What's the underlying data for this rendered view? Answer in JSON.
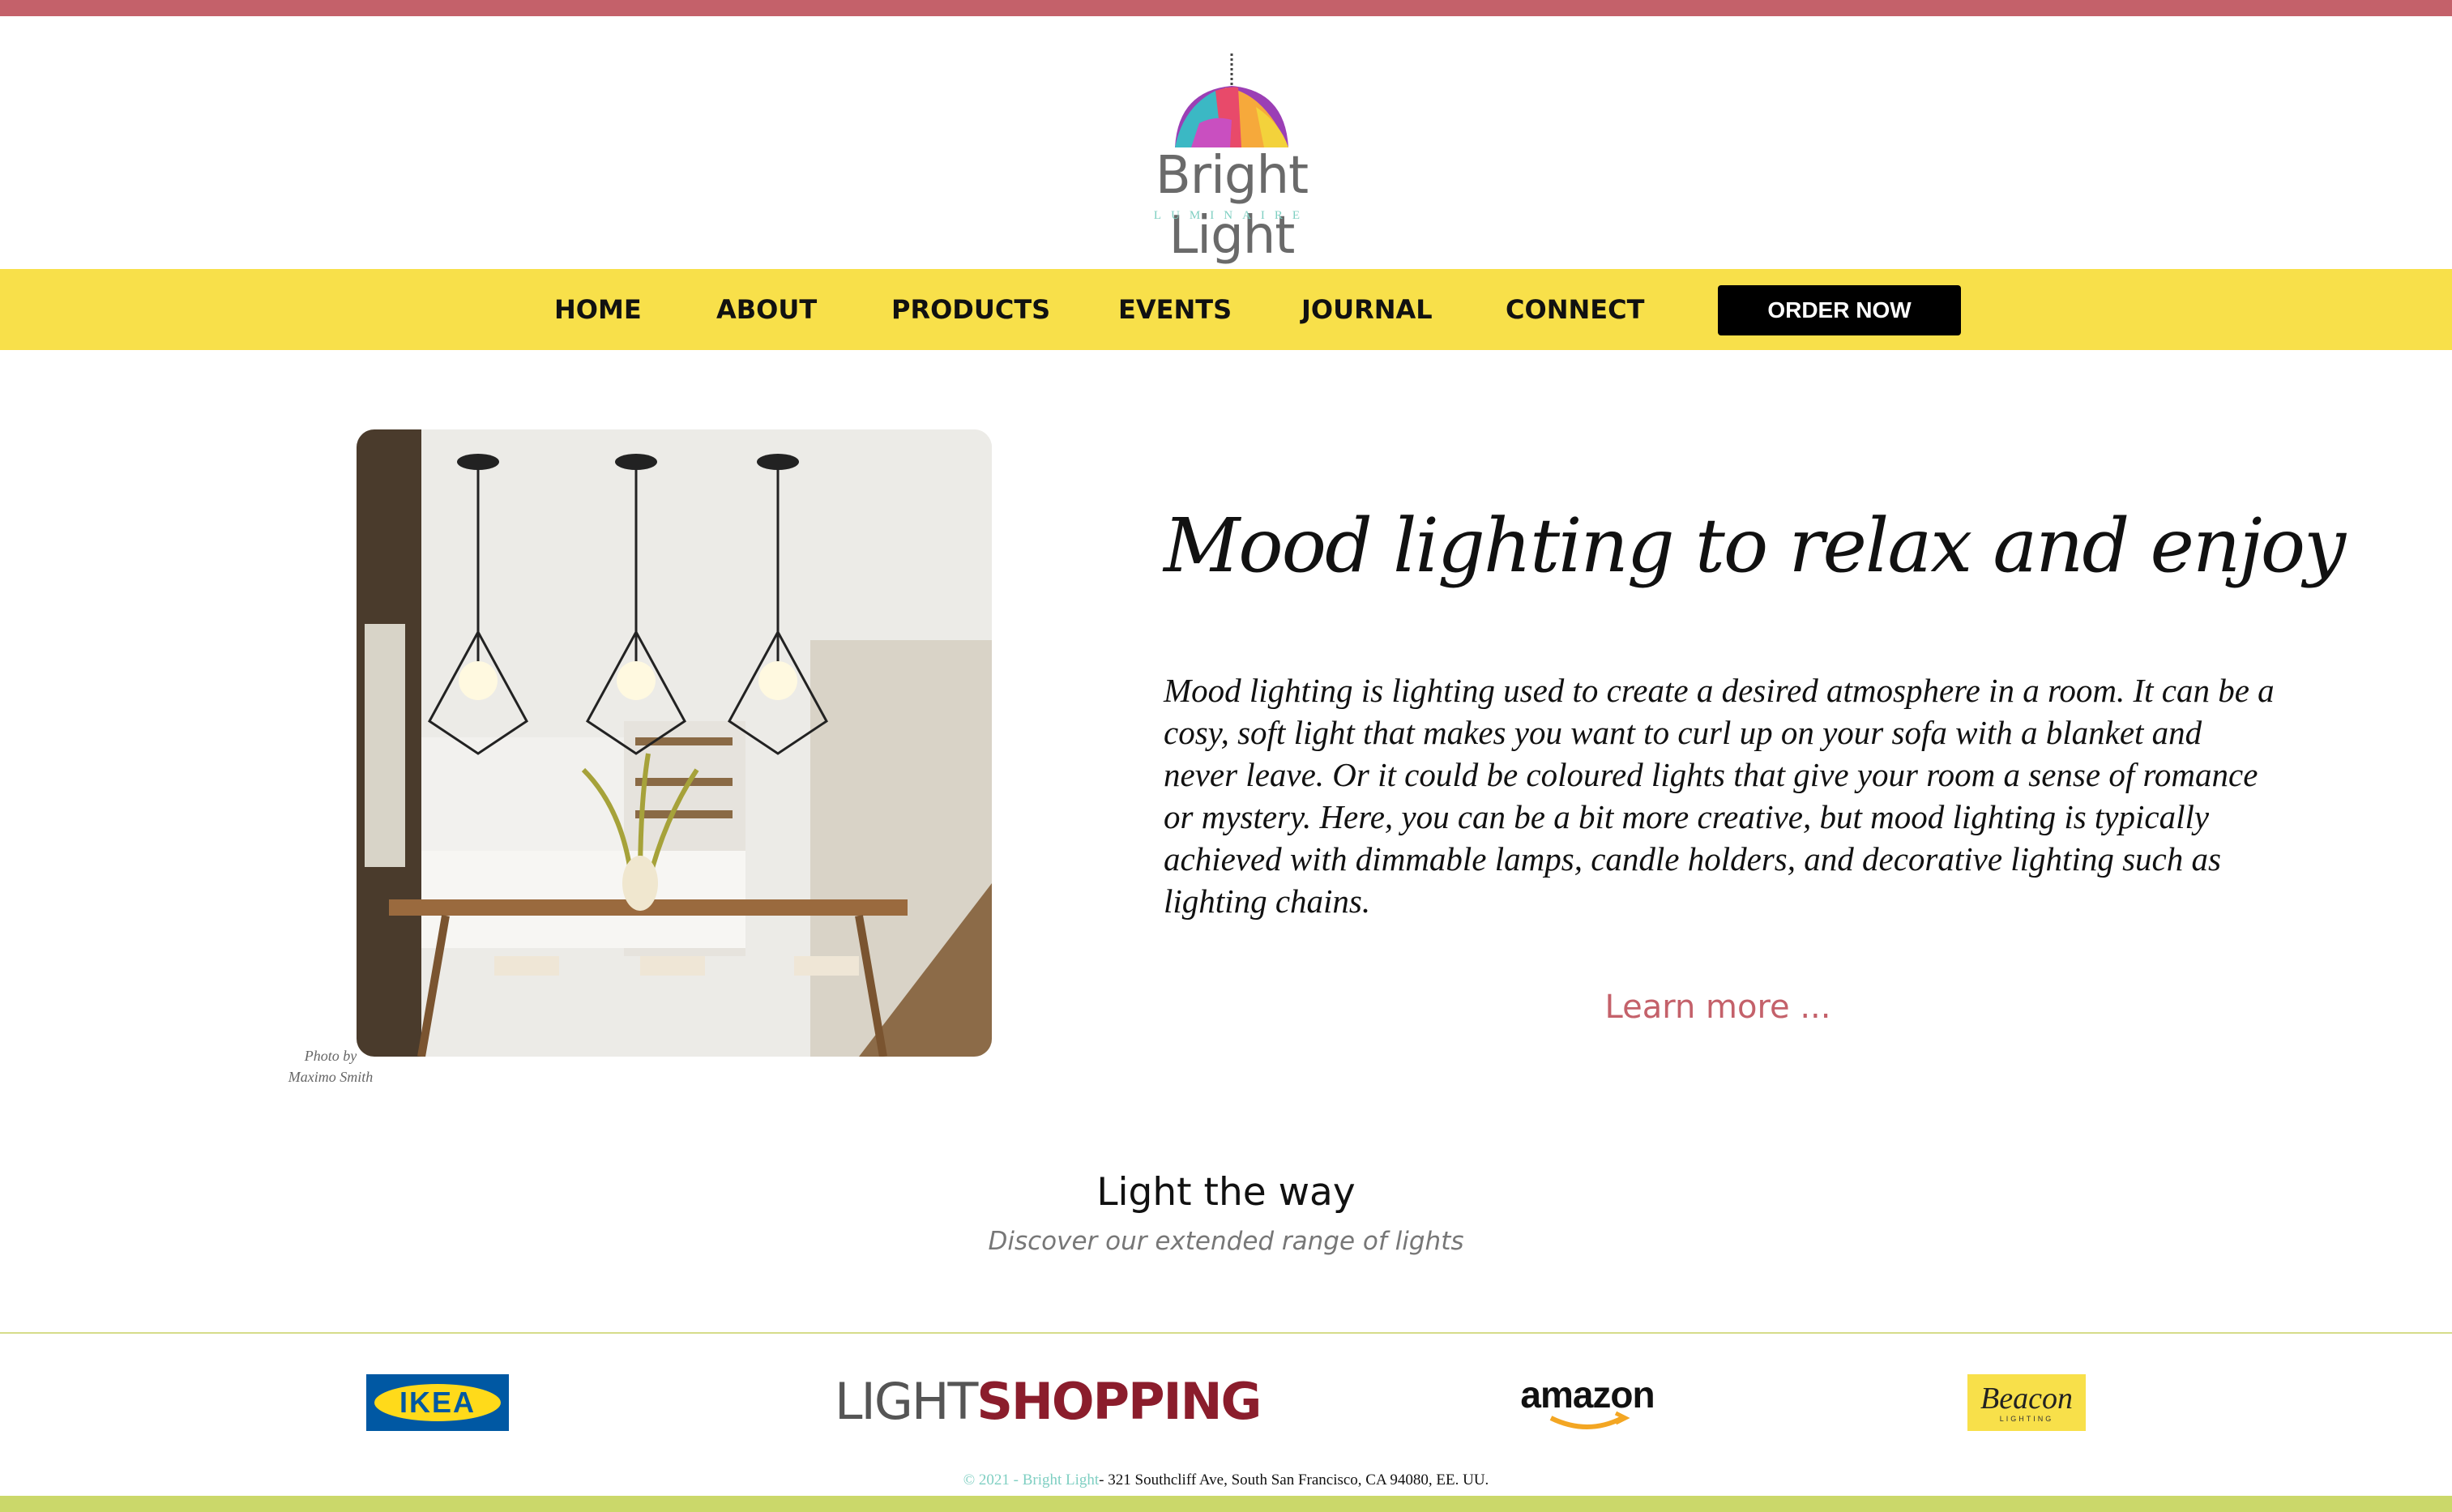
{
  "brand": {
    "name": "Bright Light",
    "sub": "LUMINAIRE"
  },
  "nav": {
    "items": [
      {
        "label": "HOME"
      },
      {
        "label": "ABOUT"
      },
      {
        "label": "PRODUCTS"
      },
      {
        "label": "EVENTS"
      },
      {
        "label": "JOURNAL"
      },
      {
        "label": "CONNECT"
      }
    ],
    "order_label": "ORDER NOW"
  },
  "hero": {
    "photo_credit_line1": "Photo by",
    "photo_credit_line2": "Maximo Smith",
    "heading": "Mood lighting to relax and enjoy",
    "body": "Mood lighting is lighting used to create a desired atmosphere in a room. It can be a cosy, soft light that makes you want to curl up on your sofa with a blanket and never leave. Or it could be coloured lights that give your room a sense of romance or mystery. Here, you can be a bit more creative, but mood lighting is typically achieved with dimmable lamps, candle holders, and decorative lighting such as lighting chains.",
    "learn_more": "Learn more ..."
  },
  "section": {
    "title": "Light the way",
    "subtitle": "Discover our extended range of lights"
  },
  "partners": {
    "ikea": "IKEA",
    "lightshopping_light": "LIGHT",
    "lightshopping_shopping": "SHOPPING",
    "amazon": "amazon",
    "beacon": "Beacon",
    "beacon_small": "LIGHTING"
  },
  "footer": {
    "copyright": "© 2021 - Bright Light",
    "address": "- 321 Southcliff Ave, South San Francisco, CA 94080, EE. UU."
  },
  "colors": {
    "accent_red": "#c4616a",
    "nav_yellow": "#f8e04a",
    "footer_green": "#cbd86a",
    "teal": "#7fcfc2"
  }
}
